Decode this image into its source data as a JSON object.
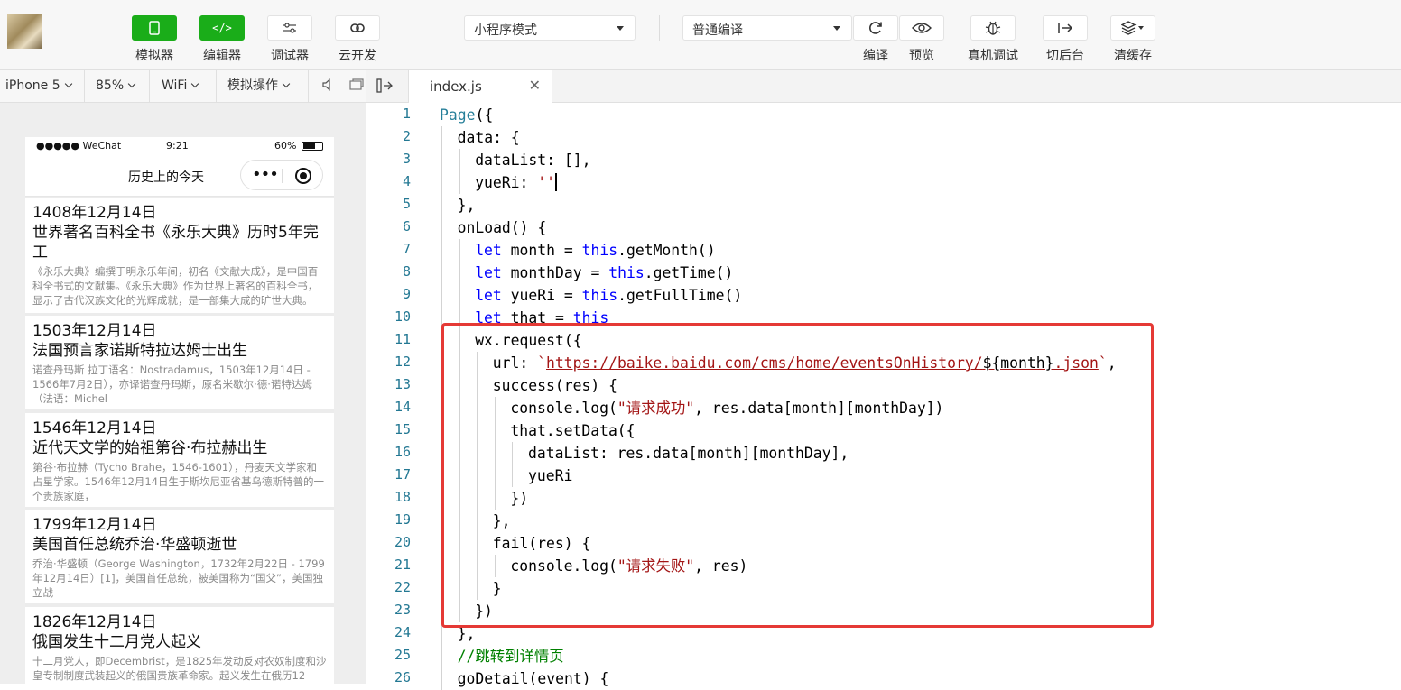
{
  "toolbar": {
    "left_tools": [
      {
        "id": "simulator",
        "label": "模拟器",
        "icon": "phone-icon",
        "active": true
      },
      {
        "id": "editor",
        "label": "编辑器",
        "icon": "code-icon",
        "active": true
      },
      {
        "id": "debugger",
        "label": "调试器",
        "icon": "settings-sliders-icon",
        "active": false
      },
      {
        "id": "cloud",
        "label": "云开发",
        "icon": "cloud-link-icon",
        "active": false
      }
    ],
    "mode_select": "小程序模式",
    "compile_select": "普通编译",
    "right_tools": [
      {
        "id": "compile",
        "label": "编译",
        "icon": "refresh-icon"
      },
      {
        "id": "preview",
        "label": "预览",
        "icon": "eye-icon"
      },
      {
        "id": "remote_debug",
        "label": "真机调试",
        "icon": "bug-icon"
      },
      {
        "id": "background",
        "label": "切后台",
        "icon": "exit-icon"
      },
      {
        "id": "clear_cache",
        "label": "清缓存",
        "icon": "layers-icon"
      }
    ]
  },
  "devbar": {
    "device": "iPhone 5",
    "zoom": "85%",
    "network": "WiFi",
    "operation": "模拟操作"
  },
  "tab": {
    "filename": "index.js",
    "close": "✕"
  },
  "phone": {
    "status": {
      "signal": "●●●●● WeChat",
      "time": "9:21",
      "battery": "60%"
    },
    "nav_title": "历史上的今天",
    "capsule_dots": "•••",
    "cards": [
      {
        "date": "1408年12月14日",
        "title": "世界著名百科全书《永乐大典》历时5年完工",
        "desc": "《永乐大典》编撰于明永乐年间，初名《文献大成》，是中国百科全书式的文献集。《永乐大典》作为世界上著名的百科全书，显示了古代汉族文化的光辉成就，是一部集大成的旷世大典。"
      },
      {
        "date": "1503年12月14日",
        "title": "法国预言家诺斯特拉达姆士出生",
        "desc": "诺查丹玛斯 拉丁语名：Nostradamus，1503年12月14日 - 1566年7月2日），亦译诺查丹玛斯，原名米歇尔·德·诺特达姆（法语：Michel"
      },
      {
        "date": "1546年12月14日",
        "title": "近代天文学的始祖第谷·布拉赫出生",
        "desc": "第谷·布拉赫（Tycho Brahe，1546-1601），丹麦天文学家和占星学家。1546年12月14日生于斯坎尼亚省基乌德斯特普的一个贵族家庭，"
      },
      {
        "date": "1799年12月14日",
        "title": "美国首任总统乔治·华盛顿逝世",
        "desc": "乔治·华盛顿（George Washington，1732年2月22日 - 1799年12月14日）[1]，美国首任总统，被美国称为“国父”，美国独立战"
      },
      {
        "date": "1826年12月14日",
        "title": "俄国发生十二月党人起义",
        "desc": "十二月党人，即Decembrist，是1825年发动反对农奴制度和沙皇专制制度武装起义的俄国贵族革命家。起义发生在俄历12"
      }
    ]
  },
  "code_lines": [
    {
      "n": "1",
      "indent": 0,
      "tokens": [
        [
          "fn",
          "Page"
        ],
        [
          "p",
          "({"
        ]
      ]
    },
    {
      "n": "2",
      "indent": 1,
      "tokens": [
        [
          "p",
          "data: {"
        ]
      ]
    },
    {
      "n": "3",
      "indent": 2,
      "tokens": [
        [
          "p",
          "dataList: [],"
        ]
      ]
    },
    {
      "n": "4",
      "indent": 2,
      "tokens": [
        [
          "p",
          "yueRi: "
        ],
        [
          "str",
          "''"
        ],
        [
          "cursor",
          ""
        ]
      ]
    },
    {
      "n": "5",
      "indent": 1,
      "tokens": [
        [
          "p",
          "},"
        ]
      ]
    },
    {
      "n": "6",
      "indent": 1,
      "tokens": [
        [
          "p",
          "onLoad() {"
        ]
      ]
    },
    {
      "n": "7",
      "indent": 2,
      "tokens": [
        [
          "kw",
          "let"
        ],
        [
          "p",
          " month = "
        ],
        [
          "kw",
          "this"
        ],
        [
          "p",
          ".getMonth()"
        ]
      ]
    },
    {
      "n": "8",
      "indent": 2,
      "tokens": [
        [
          "kw",
          "let"
        ],
        [
          "p",
          " monthDay = "
        ],
        [
          "kw",
          "this"
        ],
        [
          "p",
          ".getTime()"
        ]
      ]
    },
    {
      "n": "9",
      "indent": 2,
      "tokens": [
        [
          "kw",
          "let"
        ],
        [
          "p",
          " yueRi = "
        ],
        [
          "kw",
          "this"
        ],
        [
          "p",
          ".getFullTime()"
        ]
      ]
    },
    {
      "n": "10",
      "indent": 2,
      "tokens": [
        [
          "kw",
          "let"
        ],
        [
          "p",
          " that = "
        ],
        [
          "kw",
          "this"
        ]
      ]
    },
    {
      "n": "11",
      "indent": 2,
      "tokens": [
        [
          "p",
          "wx.request({"
        ]
      ]
    },
    {
      "n": "12",
      "indent": 3,
      "tokens": [
        [
          "p",
          "url: "
        ],
        [
          "str",
          "`"
        ],
        [
          "url",
          "https://baike.baidu.com/cms/home/eventsOnHistory/"
        ],
        [
          "tpl",
          "${month}"
        ],
        [
          "url",
          ".json"
        ],
        [
          "str",
          "`"
        ],
        [
          "p",
          ","
        ]
      ]
    },
    {
      "n": "13",
      "indent": 3,
      "tokens": [
        [
          "p",
          "success(res) {"
        ]
      ]
    },
    {
      "n": "14",
      "indent": 4,
      "tokens": [
        [
          "p",
          "console.log("
        ],
        [
          "str",
          "\"请求成功\""
        ],
        [
          "p",
          ", res.data[month][monthDay])"
        ]
      ]
    },
    {
      "n": "15",
      "indent": 4,
      "tokens": [
        [
          "p",
          "that.setData({"
        ]
      ]
    },
    {
      "n": "16",
      "indent": 5,
      "tokens": [
        [
          "p",
          "dataList: res.data[month][monthDay],"
        ]
      ]
    },
    {
      "n": "17",
      "indent": 5,
      "tokens": [
        [
          "p",
          "yueRi"
        ]
      ]
    },
    {
      "n": "18",
      "indent": 4,
      "tokens": [
        [
          "p",
          "})"
        ]
      ]
    },
    {
      "n": "19",
      "indent": 3,
      "tokens": [
        [
          "p",
          "},"
        ]
      ]
    },
    {
      "n": "20",
      "indent": 3,
      "tokens": [
        [
          "p",
          "fail(res) {"
        ]
      ]
    },
    {
      "n": "21",
      "indent": 4,
      "tokens": [
        [
          "p",
          "console.log("
        ],
        [
          "str",
          "\"请求失败\""
        ],
        [
          "p",
          ", res)"
        ]
      ]
    },
    {
      "n": "22",
      "indent": 3,
      "tokens": [
        [
          "p",
          "}"
        ]
      ]
    },
    {
      "n": "23",
      "indent": 2,
      "tokens": [
        [
          "p",
          "})"
        ]
      ]
    },
    {
      "n": "24",
      "indent": 1,
      "tokens": [
        [
          "p",
          "},"
        ]
      ]
    },
    {
      "n": "25",
      "indent": 1,
      "tokens": [
        [
          "cm",
          "//跳转到详情页"
        ]
      ]
    },
    {
      "n": "26",
      "indent": 1,
      "tokens": [
        [
          "p",
          "goDetail(event) {"
        ]
      ]
    }
  ],
  "colors": {
    "accent_green": "#1aad19",
    "keyword": "#0000ff",
    "function": "#267f99",
    "string": "#a31515",
    "comment": "#008000",
    "highlight_box": "#e53935"
  }
}
